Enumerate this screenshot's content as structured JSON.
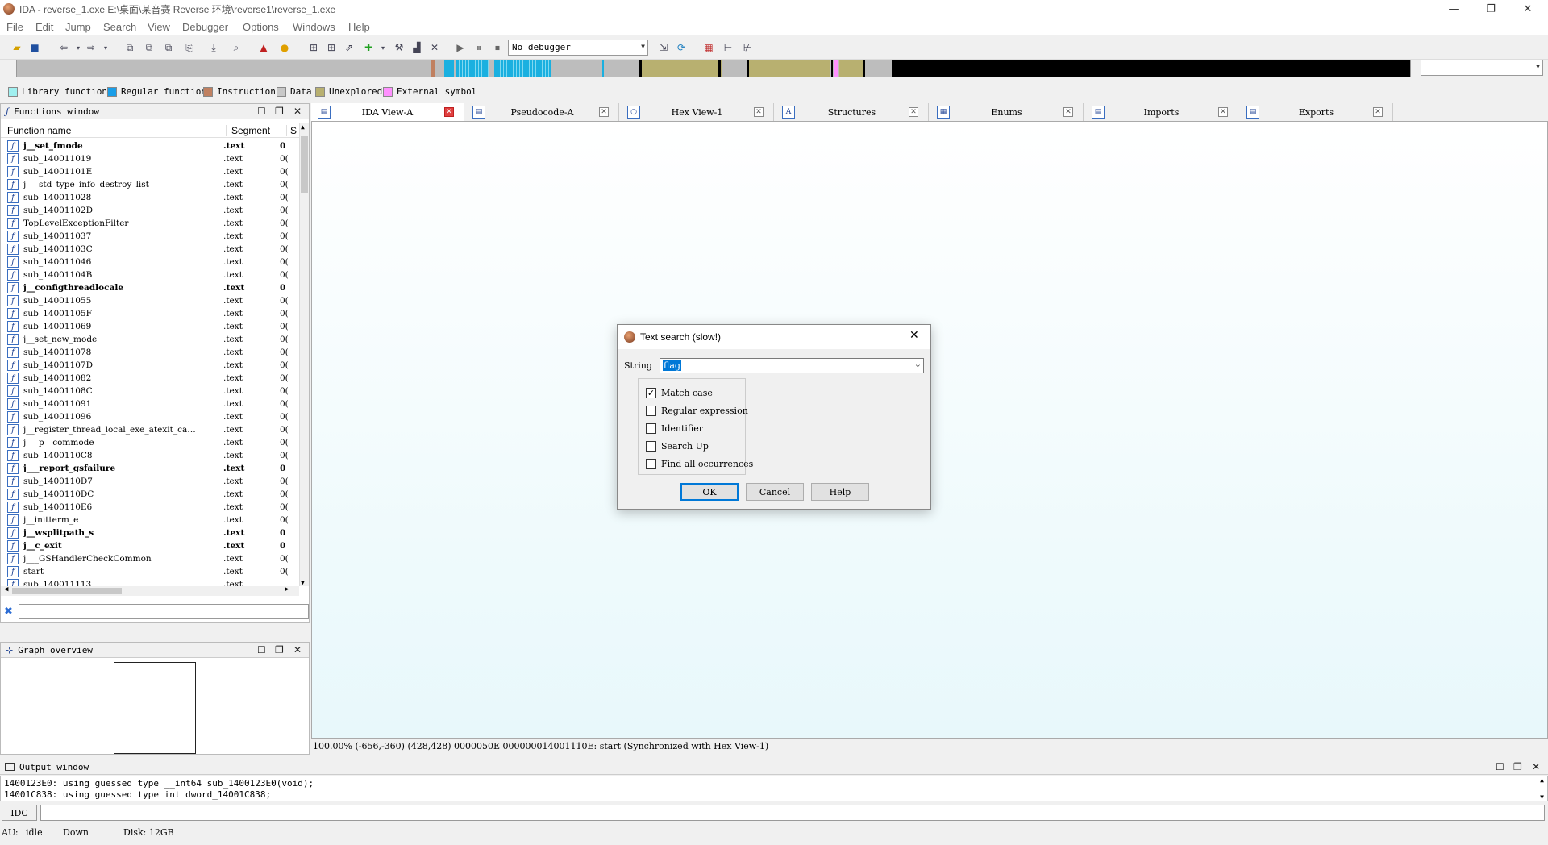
{
  "window": {
    "title": "IDA - reverse_1.exe E:\\桌面\\某音赛 Reverse 环境\\reverse1\\reverse_1.exe"
  },
  "menu": [
    "File",
    "Edit",
    "Jump",
    "Search",
    "View",
    "Debugger",
    "Options",
    "Windows",
    "Help"
  ],
  "toolbar": {
    "debugger_select": "No debugger"
  },
  "legend": [
    {
      "label": "Library function",
      "color": "#a0f0f0"
    },
    {
      "label": "Regular function",
      "color": "#1a9ee8"
    },
    {
      "label": "Instruction",
      "color": "#c08060"
    },
    {
      "label": "Data",
      "color": "#c8c8c8"
    },
    {
      "label": "Unexplored",
      "color": "#b8b070"
    },
    {
      "label": "External symbol",
      "color": "#ff90ff"
    }
  ],
  "functions_window": {
    "title": "Functions window",
    "col_name": "Function name",
    "col_segment": "Segment",
    "col_s": "S",
    "rows": [
      {
        "name": "j__set_fmode",
        "seg": ".text",
        "s": "0",
        "bold": true
      },
      {
        "name": "sub_140011019",
        "seg": ".text",
        "s": "0(",
        "bold": false
      },
      {
        "name": "sub_14001101E",
        "seg": ".text",
        "s": "0(",
        "bold": false
      },
      {
        "name": "j___std_type_info_destroy_list",
        "seg": ".text",
        "s": "0(",
        "bold": false
      },
      {
        "name": "sub_140011028",
        "seg": ".text",
        "s": "0(",
        "bold": false
      },
      {
        "name": "sub_14001102D",
        "seg": ".text",
        "s": "0(",
        "bold": false
      },
      {
        "name": "TopLevelExceptionFilter",
        "seg": ".text",
        "s": "0(",
        "bold": false
      },
      {
        "name": "sub_140011037",
        "seg": ".text",
        "s": "0(",
        "bold": false
      },
      {
        "name": "sub_14001103C",
        "seg": ".text",
        "s": "0(",
        "bold": false
      },
      {
        "name": "sub_140011046",
        "seg": ".text",
        "s": "0(",
        "bold": false
      },
      {
        "name": "sub_14001104B",
        "seg": ".text",
        "s": "0(",
        "bold": false
      },
      {
        "name": "j__configthreadlocale",
        "seg": ".text",
        "s": "0",
        "bold": true
      },
      {
        "name": "sub_140011055",
        "seg": ".text",
        "s": "0(",
        "bold": false
      },
      {
        "name": "sub_14001105F",
        "seg": ".text",
        "s": "0(",
        "bold": false
      },
      {
        "name": "sub_140011069",
        "seg": ".text",
        "s": "0(",
        "bold": false
      },
      {
        "name": "j__set_new_mode",
        "seg": ".text",
        "s": "0(",
        "bold": false
      },
      {
        "name": "sub_140011078",
        "seg": ".text",
        "s": "0(",
        "bold": false
      },
      {
        "name": "sub_14001107D",
        "seg": ".text",
        "s": "0(",
        "bold": false
      },
      {
        "name": "sub_140011082",
        "seg": ".text",
        "s": "0(",
        "bold": false
      },
      {
        "name": "sub_14001108C",
        "seg": ".text",
        "s": "0(",
        "bold": false
      },
      {
        "name": "sub_140011091",
        "seg": ".text",
        "s": "0(",
        "bold": false
      },
      {
        "name": "sub_140011096",
        "seg": ".text",
        "s": "0(",
        "bold": false
      },
      {
        "name": "j__register_thread_local_exe_atexit_ca…",
        "seg": ".text",
        "s": "0(",
        "bold": false
      },
      {
        "name": "j___p__commode",
        "seg": ".text",
        "s": "0(",
        "bold": false
      },
      {
        "name": "sub_1400110C8",
        "seg": ".text",
        "s": "0(",
        "bold": false
      },
      {
        "name": "j___report_gsfailure",
        "seg": ".text",
        "s": "0",
        "bold": true
      },
      {
        "name": "sub_1400110D7",
        "seg": ".text",
        "s": "0(",
        "bold": false
      },
      {
        "name": "sub_1400110DC",
        "seg": ".text",
        "s": "0(",
        "bold": false
      },
      {
        "name": "sub_1400110E6",
        "seg": ".text",
        "s": "0(",
        "bold": false
      },
      {
        "name": "j__initterm_e",
        "seg": ".text",
        "s": "0(",
        "bold": false
      },
      {
        "name": "j__wsplitpath_s",
        "seg": ".text",
        "s": "0",
        "bold": true
      },
      {
        "name": "j__c_exit",
        "seg": ".text",
        "s": "0",
        "bold": true
      },
      {
        "name": "j___GSHandlerCheckCommon",
        "seg": ".text",
        "s": "0(",
        "bold": false
      },
      {
        "name": "start",
        "seg": ".text",
        "s": "0(",
        "bold": false
      },
      {
        "name": "sub_140011113",
        "seg": ".text",
        "s": "",
        "bold": false
      }
    ]
  },
  "tabs": [
    {
      "label": "IDA View-A",
      "icon": "▤",
      "close_red": true
    },
    {
      "label": "Pseudocode-A",
      "icon": "▤",
      "close_red": false
    },
    {
      "label": "Hex View-1",
      "icon": "○",
      "close_red": false
    },
    {
      "label": "Structures",
      "icon": "A",
      "close_red": false
    },
    {
      "label": "Enums",
      "icon": "▦",
      "close_red": false
    },
    {
      "label": "Imports",
      "icon": "▤",
      "close_red": false
    },
    {
      "label": "Exports",
      "icon": "▤",
      "close_red": false
    }
  ],
  "status_line": "100.00% (-656,-360) (428,428) 0000050E 000000014001110E: start (Synchronized with Hex View-1)",
  "graph_overview": {
    "title": "Graph overview"
  },
  "output_window": {
    "title": "Output window",
    "lines": [
      "1400123E0: using guessed type __int64 sub_1400123E0(void);",
      "14001C838: using guessed type int dword_14001C838;"
    ]
  },
  "idc": {
    "label": "IDC"
  },
  "bottom_status": {
    "au": "AU:",
    "state": "idle",
    "dir": "Down",
    "disk": "Disk: 12GB"
  },
  "dialog": {
    "title": "Text search (slow!)",
    "string_label": "String",
    "string_value": "flag",
    "options": [
      {
        "label": "Match case",
        "checked": true
      },
      {
        "label": "Regular expression",
        "checked": false
      },
      {
        "label": "Identifier",
        "checked": false
      },
      {
        "label": "Search Up",
        "checked": false
      },
      {
        "label": "Find all occurrences",
        "checked": false
      }
    ],
    "ok": "OK",
    "cancel": "Cancel",
    "help": "Help"
  }
}
